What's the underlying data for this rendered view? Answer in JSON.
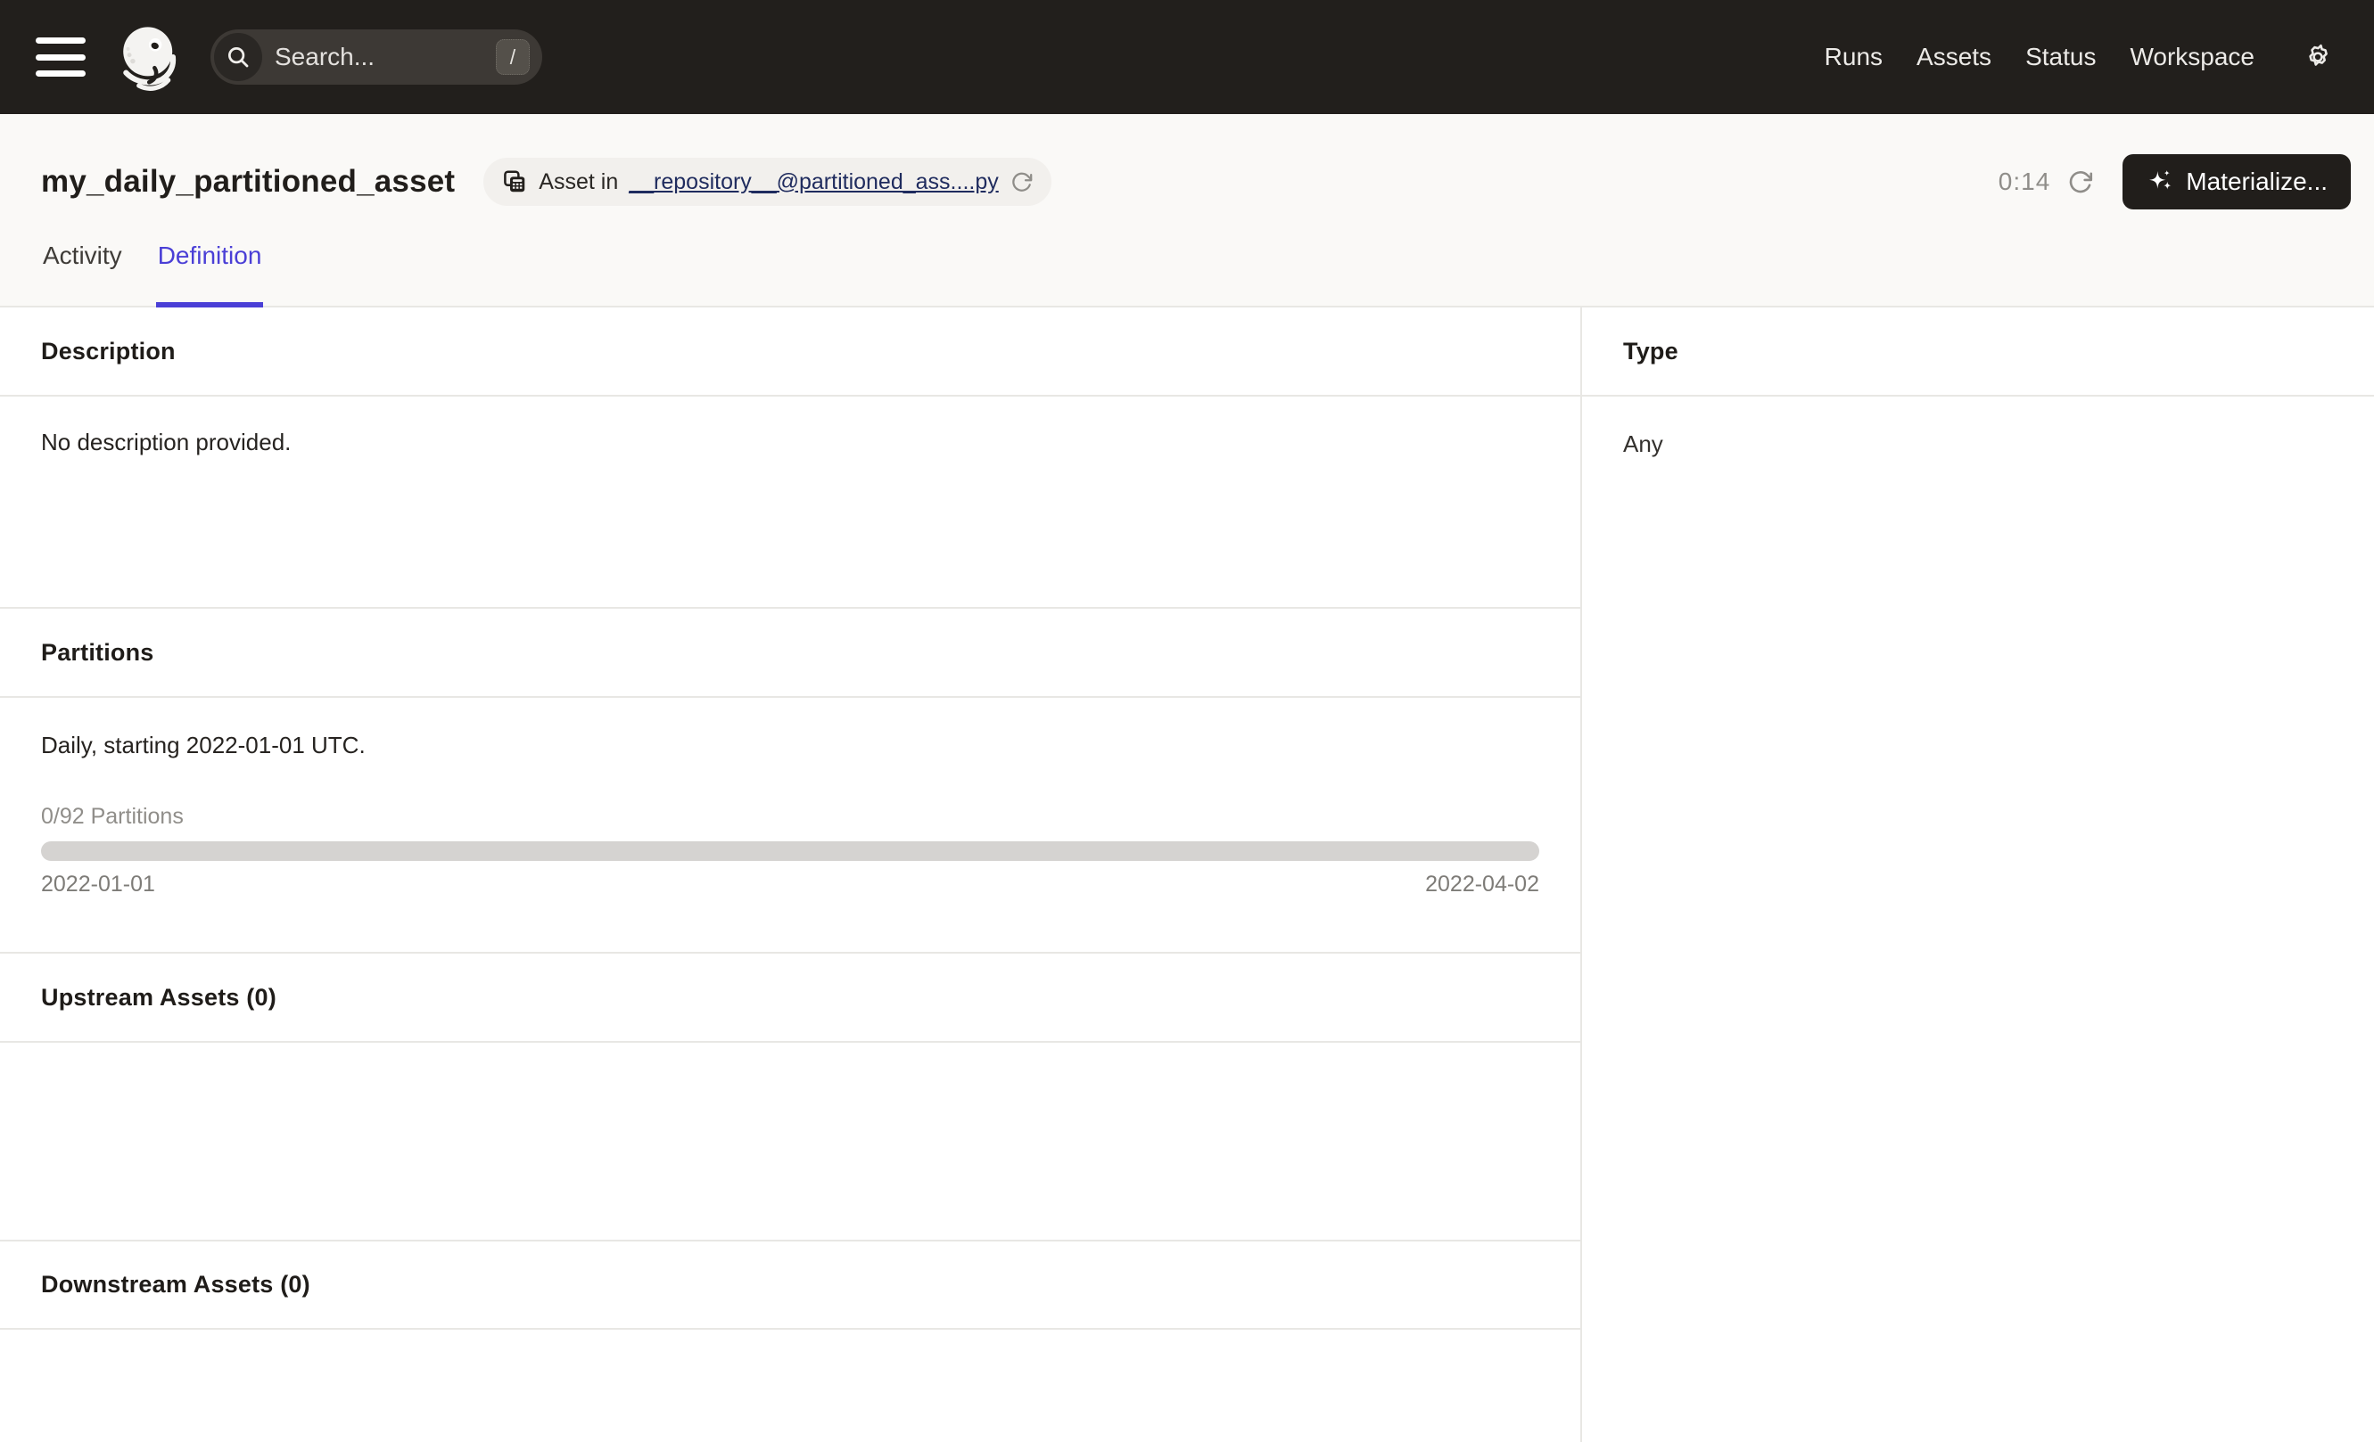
{
  "topbar": {
    "search": {
      "placeholder": "Search...",
      "shortcut": "/"
    },
    "nav_items": [
      "Runs",
      "Assets",
      "Status",
      "Workspace"
    ]
  },
  "header": {
    "title": "my_daily_partitioned_asset",
    "badge": {
      "prefix": "Asset in",
      "link": "__repository__@partitioned_ass....py"
    },
    "timer": "0:14",
    "materialize_label": "Materialize..."
  },
  "tabs": [
    {
      "label": "Activity",
      "active": false
    },
    {
      "label": "Definition",
      "active": true
    }
  ],
  "sections": {
    "description": {
      "heading": "Description",
      "body": "No description provided."
    },
    "partitions": {
      "heading": "Partitions",
      "summary": "Daily, starting 2022-01-01 UTC.",
      "progress_label": "0/92 Partitions",
      "progress_percent": 0,
      "range_start": "2022-01-01",
      "range_end": "2022-04-02"
    },
    "upstream": {
      "heading": "Upstream Assets (0)"
    },
    "downstream": {
      "heading": "Downstream Assets (0)"
    },
    "type": {
      "heading": "Type",
      "value": "Any"
    }
  },
  "colors": {
    "accent": "#4A3FD6",
    "navbar_bg": "#221F1C",
    "link_navy": "#1F2B5E",
    "border": "#E8E7E4",
    "progress_track": "#D5D3D1"
  }
}
